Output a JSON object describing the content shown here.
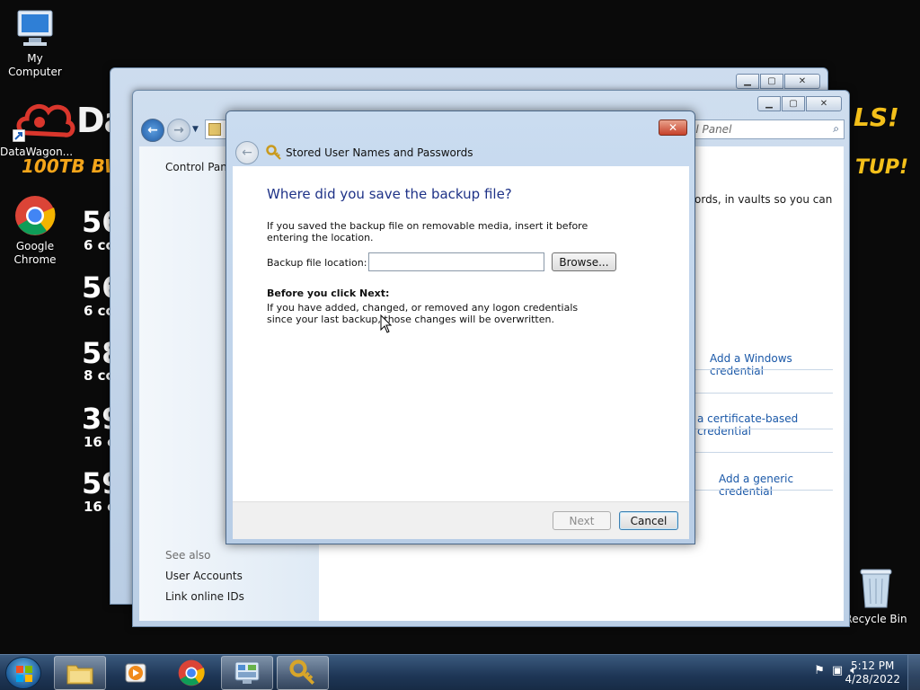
{
  "desktop": {
    "icons": [
      {
        "label": "My Computer",
        "icon": "computer-icon"
      },
      {
        "label": "DataWagon...",
        "icon": "shortcut-icon"
      },
      {
        "label": "Google Chrome",
        "icon": "chrome-icon"
      },
      {
        "label": "Recycle Bin",
        "icon": "recycle-bin-icon"
      }
    ],
    "wallpaper": {
      "brand_fragment": "Da",
      "storage_fragment": "100TB BW",
      "right_top": "LS!",
      "right_mid": "TUP!",
      "rows": [
        {
          "num": "56",
          "sub": "6 cc"
        },
        {
          "num": "56",
          "sub": "6 cc"
        },
        {
          "num": "58",
          "sub": "8 cc"
        },
        {
          "num": "39",
          "sub": "16 c"
        },
        {
          "num": "59",
          "sub": "16 c"
        }
      ]
    }
  },
  "control_panel": {
    "breadcrumb": "Control Panel",
    "search_placeholder": "ol Panel",
    "description": "ords, in vaults so you can",
    "links": {
      "add_windows": "Add a Windows credential",
      "add_certificate": "a certificate-based credential",
      "add_generic": "Add a generic credential"
    },
    "see_also": {
      "heading": "See also",
      "items": [
        "User Accounts",
        "Link online IDs"
      ]
    }
  },
  "dialog": {
    "title": "Stored User Names and Passwords",
    "heading": "Where did you save the backup file?",
    "instruction": "If you saved the backup file on removable media, insert it before entering the location.",
    "field_label": "Backup file location:",
    "field_value": "",
    "browse_label": "Browse...",
    "warning_heading": "Before you click Next:",
    "warning_text": "If you have added, changed, or removed any logon credentials since your last backup, those changes will be overwritten.",
    "next_label": "Next",
    "cancel_label": "Cancel",
    "close_glyph": "✕"
  },
  "taskbar": {
    "items": [
      "file-explorer-icon",
      "media-player-icon",
      "chrome-icon",
      "control-panel-icon",
      "credential-manager-icon"
    ],
    "time": "5:12 PM",
    "date": "4/28/2022"
  },
  "colors": {
    "heading_blue": "#1e3287",
    "link_blue": "#1a58a8",
    "close_red": "#c6412a",
    "brand_orange": "#f4a51a"
  }
}
